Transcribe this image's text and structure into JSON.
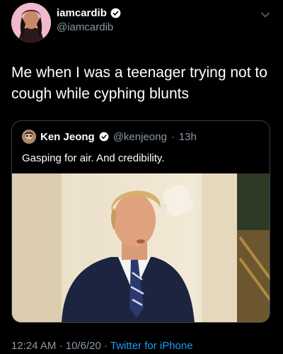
{
  "author": {
    "display_name": "iamcardib",
    "handle": "@iamcardib",
    "verified": true,
    "avatar_icon": "profile-avatar"
  },
  "tweet": {
    "text": "Me when I was a teenager trying not to cough while cyphing blunts"
  },
  "quoted_tweet": {
    "display_name": "Ken Jeong",
    "handle": "@kenjeong",
    "separator": "·",
    "time": "13h",
    "verified": true,
    "text": "Gasping for air. And credibility.",
    "media_icon": "photo-of-man-in-suit-on-balcony"
  },
  "footer": {
    "time": "12:24 AM",
    "separator1": "·",
    "date": "10/6/20",
    "separator2": "·",
    "app": "Twitter for iPhone"
  },
  "colors": {
    "background": "#000000",
    "text": "#ffffff",
    "secondary": "#8b98a5",
    "link": "#1d9bf0",
    "verified": "#1d9bf0"
  }
}
